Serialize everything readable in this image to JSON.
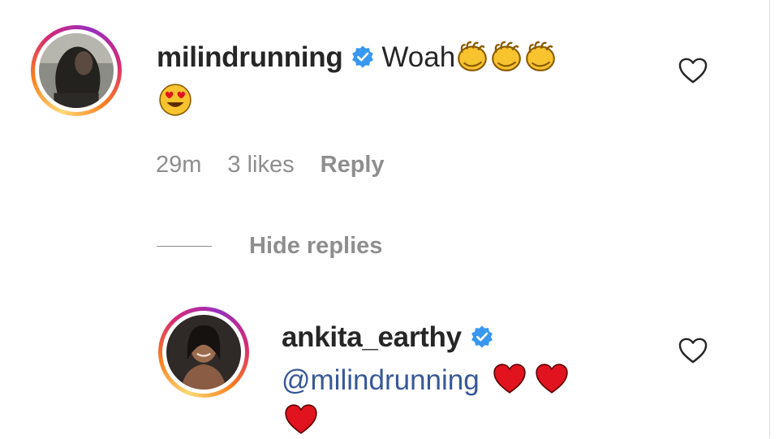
{
  "comments": [
    {
      "username": "milindrunning",
      "text": "Woah",
      "emojis_inline": [
        "clapping-hands",
        "clapping-hands",
        "clapping-hands"
      ],
      "emojis_line2": [
        "heart-eyes-face"
      ],
      "time": "29m",
      "likes": "3 likes",
      "reply_label": "Reply",
      "verified": true
    }
  ],
  "replies_toggle": {
    "label": "Hide replies"
  },
  "replies": [
    {
      "username": "ankita_earthy",
      "mention": "@milindrunning",
      "emojis_inline": [
        "red-heart",
        "red-heart"
      ],
      "emojis_line3": [
        "red-heart"
      ],
      "verified": true
    }
  ],
  "colors": {
    "verified_blue": "#3897f0",
    "mention_blue": "#385898",
    "meta_gray": "#8e8e8e",
    "heart_red": "#e0131e",
    "emoji_yellow": "#f7c32e"
  }
}
